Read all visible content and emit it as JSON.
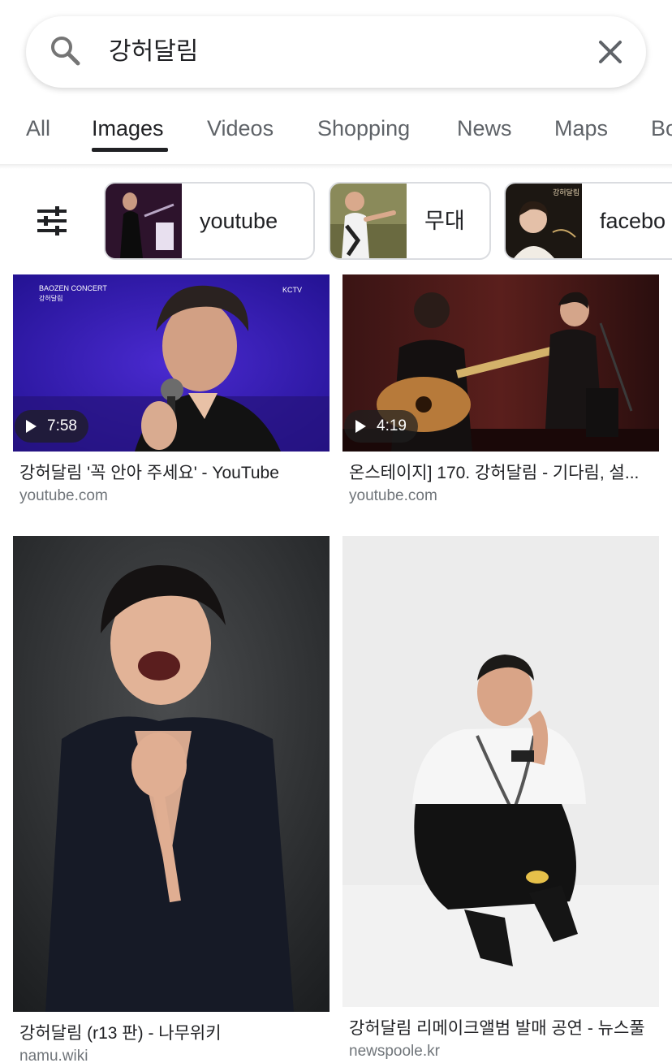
{
  "search": {
    "query": "강허달림"
  },
  "tabs": [
    {
      "label": "All"
    },
    {
      "label": "Images"
    },
    {
      "label": "Videos"
    },
    {
      "label": "Shopping"
    },
    {
      "label": "News"
    },
    {
      "label": "Maps"
    },
    {
      "label": "Bo"
    }
  ],
  "active_tab": "Images",
  "chips": [
    {
      "label": "youtube"
    },
    {
      "label": "무대"
    },
    {
      "label": "facebo"
    }
  ],
  "chip_thumb_texts": {
    "concert_poster": "강허달림 콘서트"
  },
  "results": [
    {
      "title": "강허달림 '꼭 안아 주세요' - YouTube",
      "source": "youtube.com",
      "duration": "7:58",
      "overlay_brand": "BAOZEN CONCERT",
      "overlay_sub": "강허달림",
      "overlay_channel": "KCTV"
    },
    {
      "title": "온스테이지] 170. 강허달림 - 기다림, 설...",
      "source": "youtube.com",
      "duration": "4:19"
    },
    {
      "title": "강허달림 (r13 판) - 나무위키",
      "source": "namu.wiki"
    },
    {
      "title": "강허달림 리메이크앨범 발매 공연 - 뉴스풀",
      "source": "newspoole.kr"
    }
  ],
  "colors": {
    "active_tab": "#202124",
    "inactive_tab": "#5f6368",
    "source_text": "#70757a",
    "chip_border": "#dadce0"
  }
}
